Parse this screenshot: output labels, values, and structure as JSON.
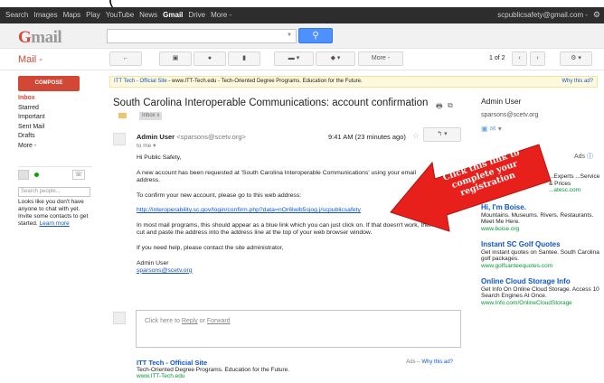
{
  "caption": "(                                                     ",
  "topbar": {
    "nav": [
      "Search",
      "Images",
      "Maps",
      "Play",
      "YouTube",
      "News",
      "Gmail",
      "Drive",
      "More -"
    ],
    "active": "Gmail",
    "email": "scpublicsafety@gmail.com -"
  },
  "header": {
    "logo_g": "G",
    "logo_rest": "mail"
  },
  "toolbar": {
    "mail_label": "Mail -",
    "more_label": "More -",
    "pager": "1 of 2"
  },
  "sidebar": {
    "compose": "COMPOSE",
    "items": [
      "Inbox",
      "Starred",
      "Important",
      "Sent Mail",
      "Drafts",
      "More -"
    ],
    "search_people_placeholder": "Search people...",
    "chat_note": "Looks like you don't have anyone to chat with yet. Invite some contacts to get started.",
    "learn_more": "Learn more"
  },
  "ad_strip": {
    "title": "ITT Tech - Official Site",
    "text": " - www.ITT-Tech.edu - Tech-Oriented Degree Programs. Education for the Future.",
    "why": "Why this ad?"
  },
  "message": {
    "subject": "South Carolina Interoperable Communications: account confirmation",
    "inbox_tag": "Inbox  x",
    "sender_name": "Admin User",
    "sender_email": "<sparsons@scetv.org>",
    "to": "to me",
    "time": "9:41 AM (23 minutes ago)",
    "greeting": "Hi Public Safety,",
    "para1": "A new account has been requested at 'South Carolina Interoperable Communications' using your email address.",
    "para2": "To confirm your new account, please go to this web address:",
    "link": "http://interoperability.sc.gov/login/confirm.php?data=nOr6lwib5sjog.j/scpublicsafety",
    "para3": "In most mail programs, this should appear as a blue link which you can just click on.  If that doesn't work, then cut and paste the address into the address line at the top of your web browser window.",
    "para4": "If you need help, please contact the site administrator,",
    "sign_name": "Admin User",
    "sign_email": "sparsons@scetv.org"
  },
  "reply_box": {
    "prefix": "Click here to ",
    "reply": "Reply",
    "or": " or ",
    "forward": "Forward"
  },
  "bottom_ad": {
    "title": "ITT Tech - Official Site",
    "desc": "Tech-Oriented Degree Programs. Education for the Future.",
    "url": "www.ITT-Tech.edu",
    "ads_label": "Ads – ",
    "why": "Why this ad?"
  },
  "right_column": {
    "name": "Admin User",
    "email": "sparsons@scetv.org",
    "ads_label": "Ads",
    "ads": [
      {
        "title": "",
        "desc": "...Experts ...Service & Prices",
        "url": "...atesc.com"
      },
      {
        "title": "Hi, I'm Boise.",
        "desc": "Mountains. Museums. Rivers. Restaurants. Meet Me Here.",
        "url": "www.boise.org"
      },
      {
        "title": "Instant SC Golf Quotes",
        "desc": "Get instant quotes on Santee. South Carolina golf packages.",
        "url": "www.golfsanteequotes.com"
      },
      {
        "title": "Online Cloud Storage Info",
        "desc": "Get Info On Online Cloud Storage. Access 10 Search Engines At Once.",
        "url": "www.Info.com/OnlineCloudStorage"
      }
    ]
  },
  "annotation": {
    "text": "Click this link to complete your registration",
    "color": "#e8201b"
  }
}
